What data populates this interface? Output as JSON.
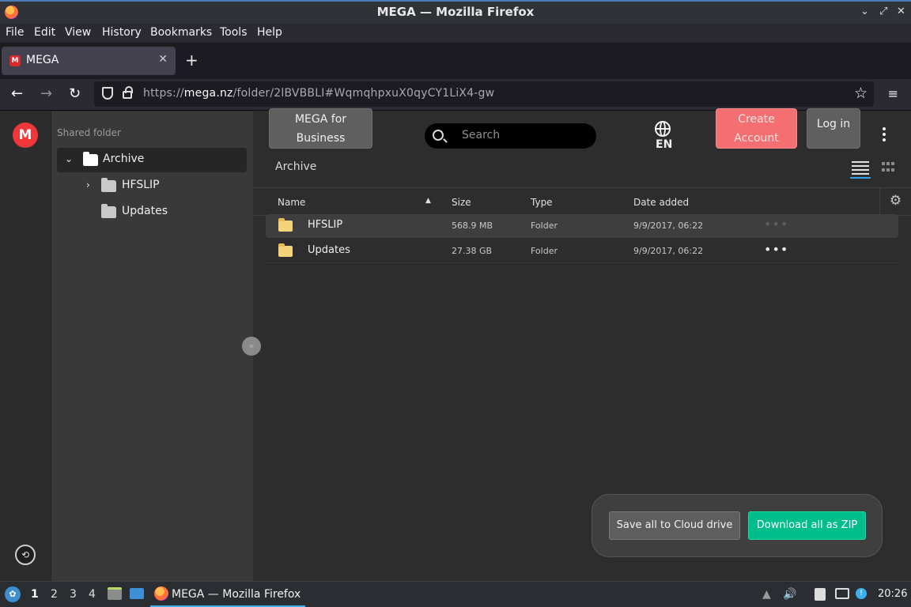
{
  "window": {
    "title": "MEGA — Mozilla Firefox",
    "controls": [
      "⌄",
      "⤢",
      "✕"
    ]
  },
  "menu": {
    "file": "File",
    "edit": "Edit",
    "view": "View",
    "history": "History",
    "bookmarks": "Bookmarks",
    "tools": "Tools",
    "help": "Help"
  },
  "tab": {
    "label": "MEGA",
    "favicon": "M",
    "close": "✕",
    "new": "+"
  },
  "nav": {
    "back": "←",
    "forward": "→",
    "reload": "↻",
    "url_prefix": "https://",
    "url_host": "mega.nz",
    "url_path": "/folder/2lBVBBLI#WqmqhpxuX0qyCY1LiX4-gw",
    "star": "☆",
    "menu": "≡"
  },
  "mega": {
    "logo": "M",
    "rail_icon": "⟲",
    "shared_folder_label": "Shared folder",
    "tree": [
      {
        "label": "Archive",
        "chevron": "⌄"
      },
      {
        "label": "HFSLIP",
        "chevron": "›"
      },
      {
        "label": "Updates"
      }
    ],
    "collapse": "«",
    "business_button": "MEGA for Business",
    "search_placeholder": "Search",
    "language": "EN",
    "create_account": "Create Account",
    "login": "Log in",
    "breadcrumb": "Archive",
    "columns": {
      "name": "Name",
      "size": "Size",
      "type": "Type",
      "date": "Date added",
      "sort": "▲",
      "settings": "⚙"
    },
    "rows": [
      {
        "name": "HFSLIP",
        "size": "568.9 MB",
        "type": "Folder",
        "date": "9/9/2017, 06:22",
        "more": "•••"
      },
      {
        "name": "Updates",
        "size": "27.38 GB",
        "type": "Folder",
        "date": "9/9/2017, 06:22",
        "more": "•••"
      }
    ],
    "save_all": "Save all to Cloud drive",
    "download_zip": "Download all as ZIP"
  },
  "taskbar": {
    "start": "✿",
    "workspaces": [
      "1",
      "2",
      "3",
      "4"
    ],
    "app_label": "MEGA — Mozilla Firefox",
    "tray": {
      "up": "▲",
      "volume": "🔊",
      "info": "!"
    },
    "clock": "20:26"
  },
  "colors": {
    "accent_red": "#f0373a",
    "zip_green": "#00be8c",
    "create_red": "#f46f71",
    "selection_blue": "#2aa3e0"
  }
}
